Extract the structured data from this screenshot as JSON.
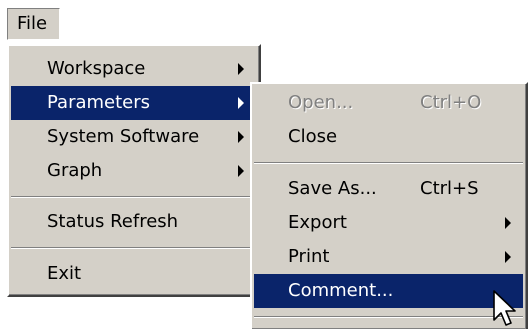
{
  "menubar": {
    "file_label": "File"
  },
  "file_menu": {
    "items": [
      {
        "label": "Workspace"
      },
      {
        "label": "Parameters"
      },
      {
        "label": "System Software"
      },
      {
        "label": "Graph"
      },
      {
        "label": "Status Refresh"
      },
      {
        "label": "Exit"
      }
    ]
  },
  "parameters_menu": {
    "items": [
      {
        "label": "Open...",
        "shortcut": "Ctrl+O"
      },
      {
        "label": "Close"
      },
      {
        "label": "Save As...",
        "shortcut": "Ctrl+S"
      },
      {
        "label": "Export"
      },
      {
        "label": "Print"
      },
      {
        "label": "Comment..."
      }
    ]
  },
  "colors": {
    "menu_face": "#d4d0c8",
    "highlight": "#0a246a",
    "disabled_text": "#808080"
  }
}
